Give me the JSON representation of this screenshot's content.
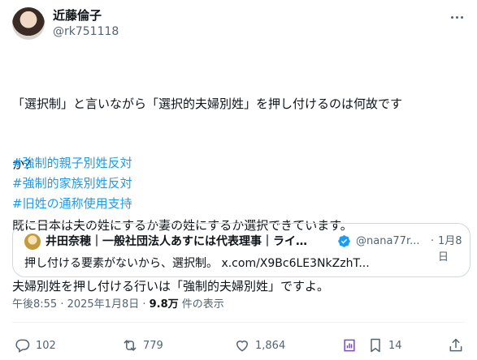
{
  "author": {
    "name": "近藤倫子",
    "handle": "@rk751118"
  },
  "post": {
    "lines": [
      "「選択制」と言いながら「選択的夫婦別姓」を押し付けるのは何故です",
      "か？",
      "既に日本は夫の姓にするか妻の姓にするか選択できています。",
      "夫婦別姓を押し付ける行いは「強制的夫婦別姓」ですよ。"
    ],
    "hashtags": [
      "#強制的親子別姓反対",
      "#強制的家族別姓反対",
      "#旧姓の通称使用支持"
    ]
  },
  "quote": {
    "name": "井田奈穂｜一般社団法人あすには代表理事｜ライ…",
    "handle": "@nana77r...",
    "dot": "·",
    "date": "1月8日",
    "text": "押し付ける要素がないから、選択制。 x.com/X9Bc6LE3NkZzhT..."
  },
  "meta": {
    "time": "午後8:55 · 2025年1月8日 · ",
    "views": "9.8万",
    "views_suffix": " 件の表示"
  },
  "actions": {
    "replies": "102",
    "reposts": "779",
    "likes": "1,864",
    "bookmarks": "14"
  },
  "colors": {
    "accent": "#1d9bf0",
    "muted": "#536471",
    "border": "#cfd9de",
    "bookmark": "#794bc4"
  }
}
